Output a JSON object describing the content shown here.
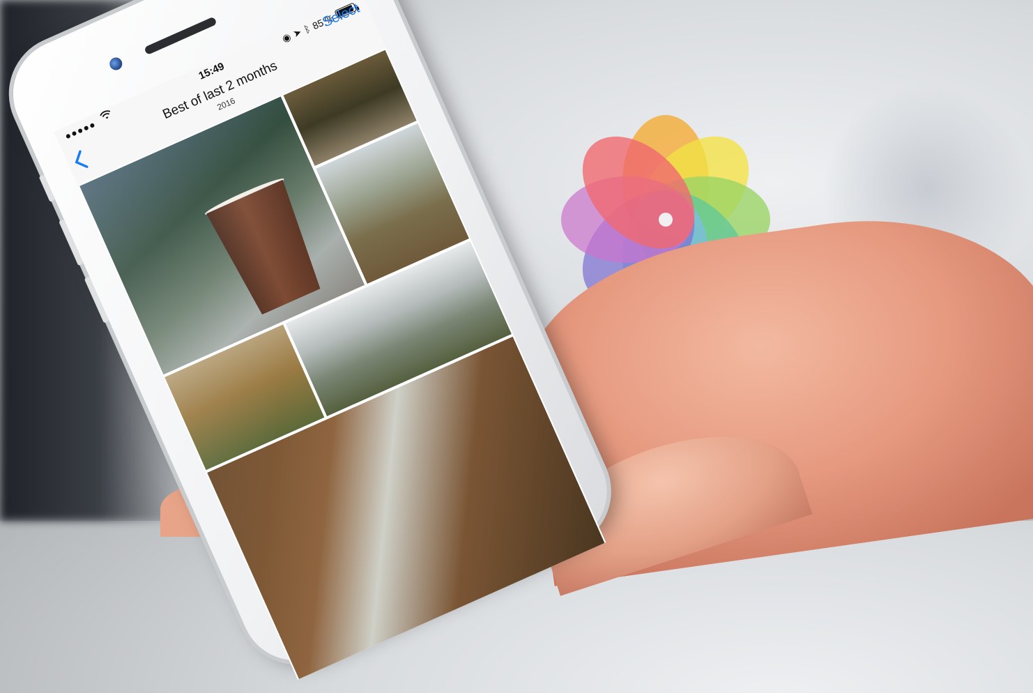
{
  "status_bar": {
    "signal": "●●●●●",
    "time": "15:49",
    "battery_text": "85 %",
    "battery_level": 0.85,
    "wifi_icon": "wifi-icon",
    "location_icon": "location-icon",
    "bluetooth_icon": "bluetooth-icon",
    "lock_icon": "rotation-lock-icon"
  },
  "nav": {
    "title": "Best of last 2 months",
    "subtitle": "2016",
    "select_label": "Select",
    "back_icon": "chevron-left-icon"
  },
  "photos": [
    {
      "name": "photo-coffee-cup-snow"
    },
    {
      "name": "photo-autumn-park-path"
    },
    {
      "name": "photo-city-rooftops"
    },
    {
      "name": "photo-autumn-buildings"
    },
    {
      "name": "photo-city-panorama"
    },
    {
      "name": "photo-autumn-trees"
    }
  ],
  "colors": {
    "accent": "#1a7cf3",
    "logo_petals": [
      "#f6a623",
      "#f5e12a",
      "#8fd14f",
      "#4cc38a",
      "#6cb7e6",
      "#6a5acd",
      "#c860c8",
      "#f2545b"
    ]
  },
  "logo_icon": "photos-app-icon"
}
